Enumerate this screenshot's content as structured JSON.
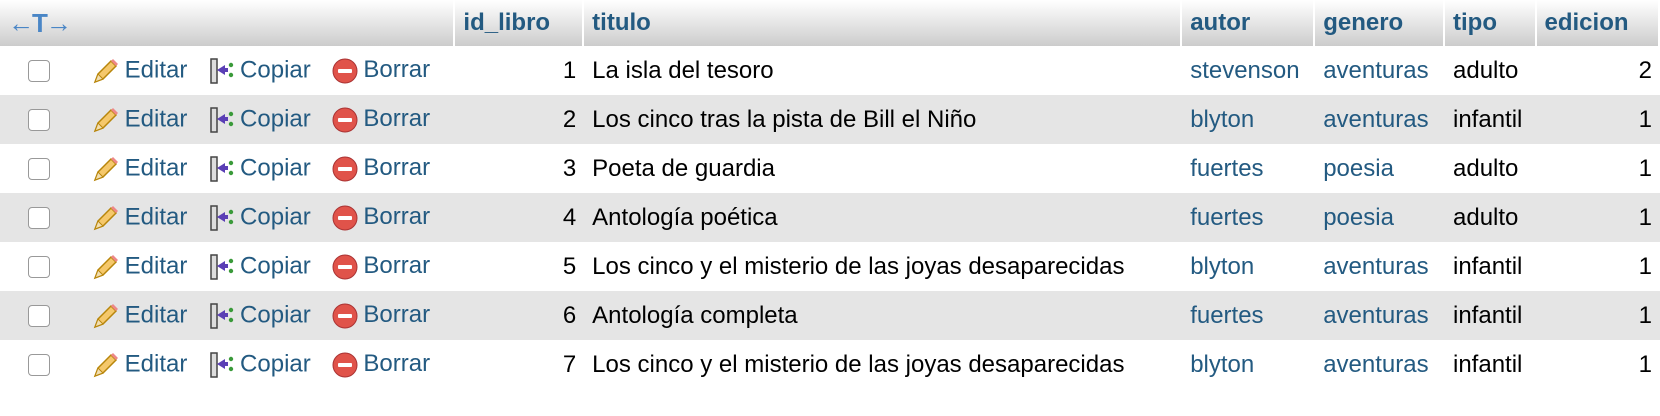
{
  "header": {
    "resize_glyph": "←T→",
    "columns": [
      "id_libro",
      "titulo",
      "autor",
      "genero",
      "tipo",
      "edicion"
    ]
  },
  "actions": {
    "edit_label": "Editar",
    "copy_label": "Copiar",
    "delete_label": "Borrar",
    "edit_icon": "pencil-icon",
    "copy_icon": "copy-insert-icon",
    "delete_icon": "delete-circle-icon"
  },
  "colors": {
    "link": "#235a81",
    "row_alt": "#e5e5e5",
    "delete_red": "#d9534f"
  },
  "rows": [
    {
      "id_libro": "1",
      "titulo": "La isla del tesoro",
      "autor": "stevenson",
      "genero": "aventuras",
      "tipo": "adulto",
      "edicion": "2"
    },
    {
      "id_libro": "2",
      "titulo": "Los cinco tras la pista de Bill el Niño",
      "autor": "blyton",
      "genero": "aventuras",
      "tipo": "infantil",
      "edicion": "1"
    },
    {
      "id_libro": "3",
      "titulo": "Poeta de guardia",
      "autor": "fuertes",
      "genero": "poesia",
      "tipo": "adulto",
      "edicion": "1"
    },
    {
      "id_libro": "4",
      "titulo": "Antología poética",
      "autor": "fuertes",
      "genero": "poesia",
      "tipo": "adulto",
      "edicion": "1"
    },
    {
      "id_libro": "5",
      "titulo": "Los cinco y el misterio de las joyas desaparecidas",
      "autor": "blyton",
      "genero": "aventuras",
      "tipo": "infantil",
      "edicion": "1"
    },
    {
      "id_libro": "6",
      "titulo": "Antología completa",
      "autor": "fuertes",
      "genero": "aventuras",
      "tipo": "infantil",
      "edicion": "1"
    },
    {
      "id_libro": "7",
      "titulo": "Los cinco y el misterio de las joyas desaparecidas",
      "autor": "blyton",
      "genero": "aventuras",
      "tipo": "infantil",
      "edicion": "1"
    }
  ]
}
